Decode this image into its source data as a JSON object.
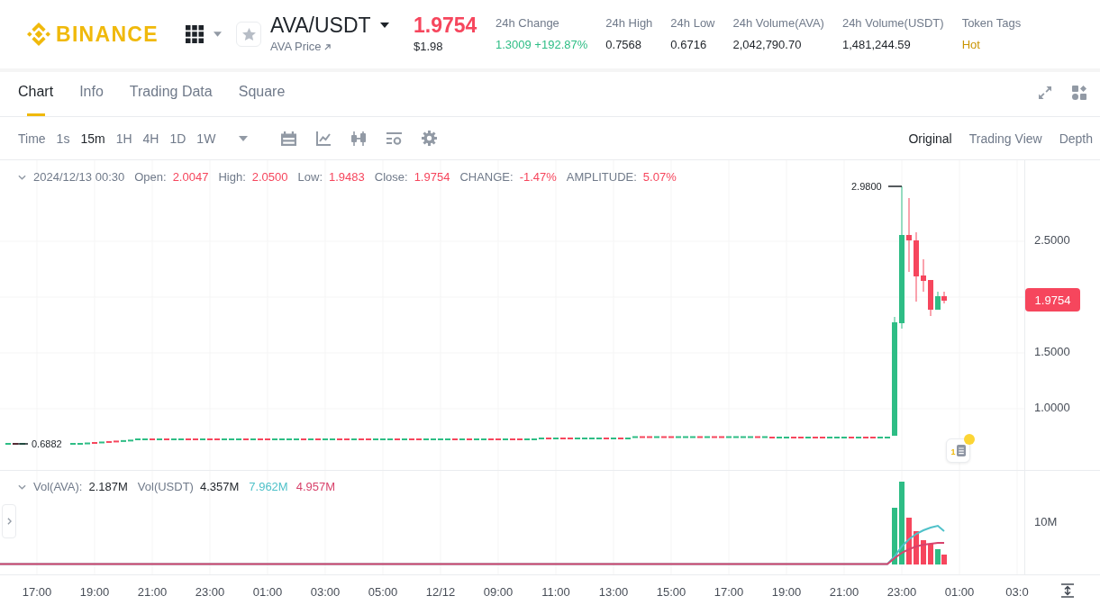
{
  "header": {
    "logo": {
      "text": "BINANCE"
    },
    "favorite": {
      "on": false
    },
    "symbol": {
      "pair": "AVA/USDT",
      "link": "AVA Price"
    },
    "price": {
      "last": "1.9754",
      "fiat": "$1.98",
      "rising": false
    },
    "stats": [
      {
        "label": "24h Change",
        "value": "1.3009 +192.87%",
        "kind": "gain"
      },
      {
        "label": "24h High",
        "value": "0.7568",
        "kind": "number"
      },
      {
        "label": "24h Low",
        "value": "0.6716",
        "kind": "number"
      },
      {
        "label": "24h Volume(AVA)",
        "value": "2,042,790.70",
        "kind": "number"
      },
      {
        "label": "24h Volume(USDT)",
        "value": "1,481,244.59",
        "kind": "number"
      },
      {
        "label": "Token Tags",
        "value": "Hot",
        "kind": "tag"
      }
    ]
  },
  "tabs": [
    {
      "label": "Chart",
      "selected": true
    },
    {
      "label": "Info",
      "selected": false
    },
    {
      "label": "Trading Data",
      "selected": false
    },
    {
      "label": "Square",
      "selected": false
    }
  ],
  "toolbar": {
    "intervals": [
      {
        "label": "Time",
        "selected": false
      },
      {
        "label": "1s",
        "selected": false
      },
      {
        "label": "15m",
        "selected": true
      },
      {
        "label": "1H",
        "selected": false
      },
      {
        "label": "4H",
        "selected": false
      },
      {
        "label": "1D",
        "selected": false
      },
      {
        "label": "1W",
        "selected": false
      }
    ],
    "views": [
      {
        "label": "Original",
        "selected": true
      },
      {
        "label": "Trading View",
        "selected": false
      },
      {
        "label": "Depth",
        "selected": false
      }
    ]
  },
  "chart": {
    "legend": {
      "date": "2024/12/13 00:30",
      "rising": false,
      "fields": [
        {
          "label": "Open:",
          "value": "2.0047"
        },
        {
          "label": "High:",
          "value": "2.0500"
        },
        {
          "label": "Low:",
          "value": "1.9483"
        },
        {
          "label": "Close:",
          "value": "1.9754"
        },
        {
          "label": "CHANGE:",
          "value": "-1.47%"
        },
        {
          "label": "AMPLITUDE:",
          "value": "5.07%"
        }
      ]
    },
    "high_marker": "2.9800",
    "low_marker": "0.6882",
    "price_axis": [
      "2.5000",
      "1.5000",
      "1.0000"
    ],
    "current_price": "1.9754",
    "event_marker": {
      "count": "1"
    }
  },
  "volume": {
    "fields": [
      {
        "label": "Vol(AVA):",
        "value": "2.187M"
      },
      {
        "label": "Vol(USDT)",
        "value": "4.357M"
      }
    ],
    "averages": [
      {
        "value": "7.962M",
        "color": "#4fc1c9"
      },
      {
        "value": "4.957M",
        "color": "#d8436c"
      }
    ],
    "axis": [
      "10M"
    ]
  },
  "time_axis": [
    "17:00",
    "19:00",
    "21:00",
    "23:00",
    "01:00",
    "03:00",
    "05:00",
    "12/12",
    "09:00",
    "11:00",
    "13:00",
    "15:00",
    "17:00",
    "19:00",
    "21:00",
    "23:00",
    "01:00",
    "03:0"
  ]
}
